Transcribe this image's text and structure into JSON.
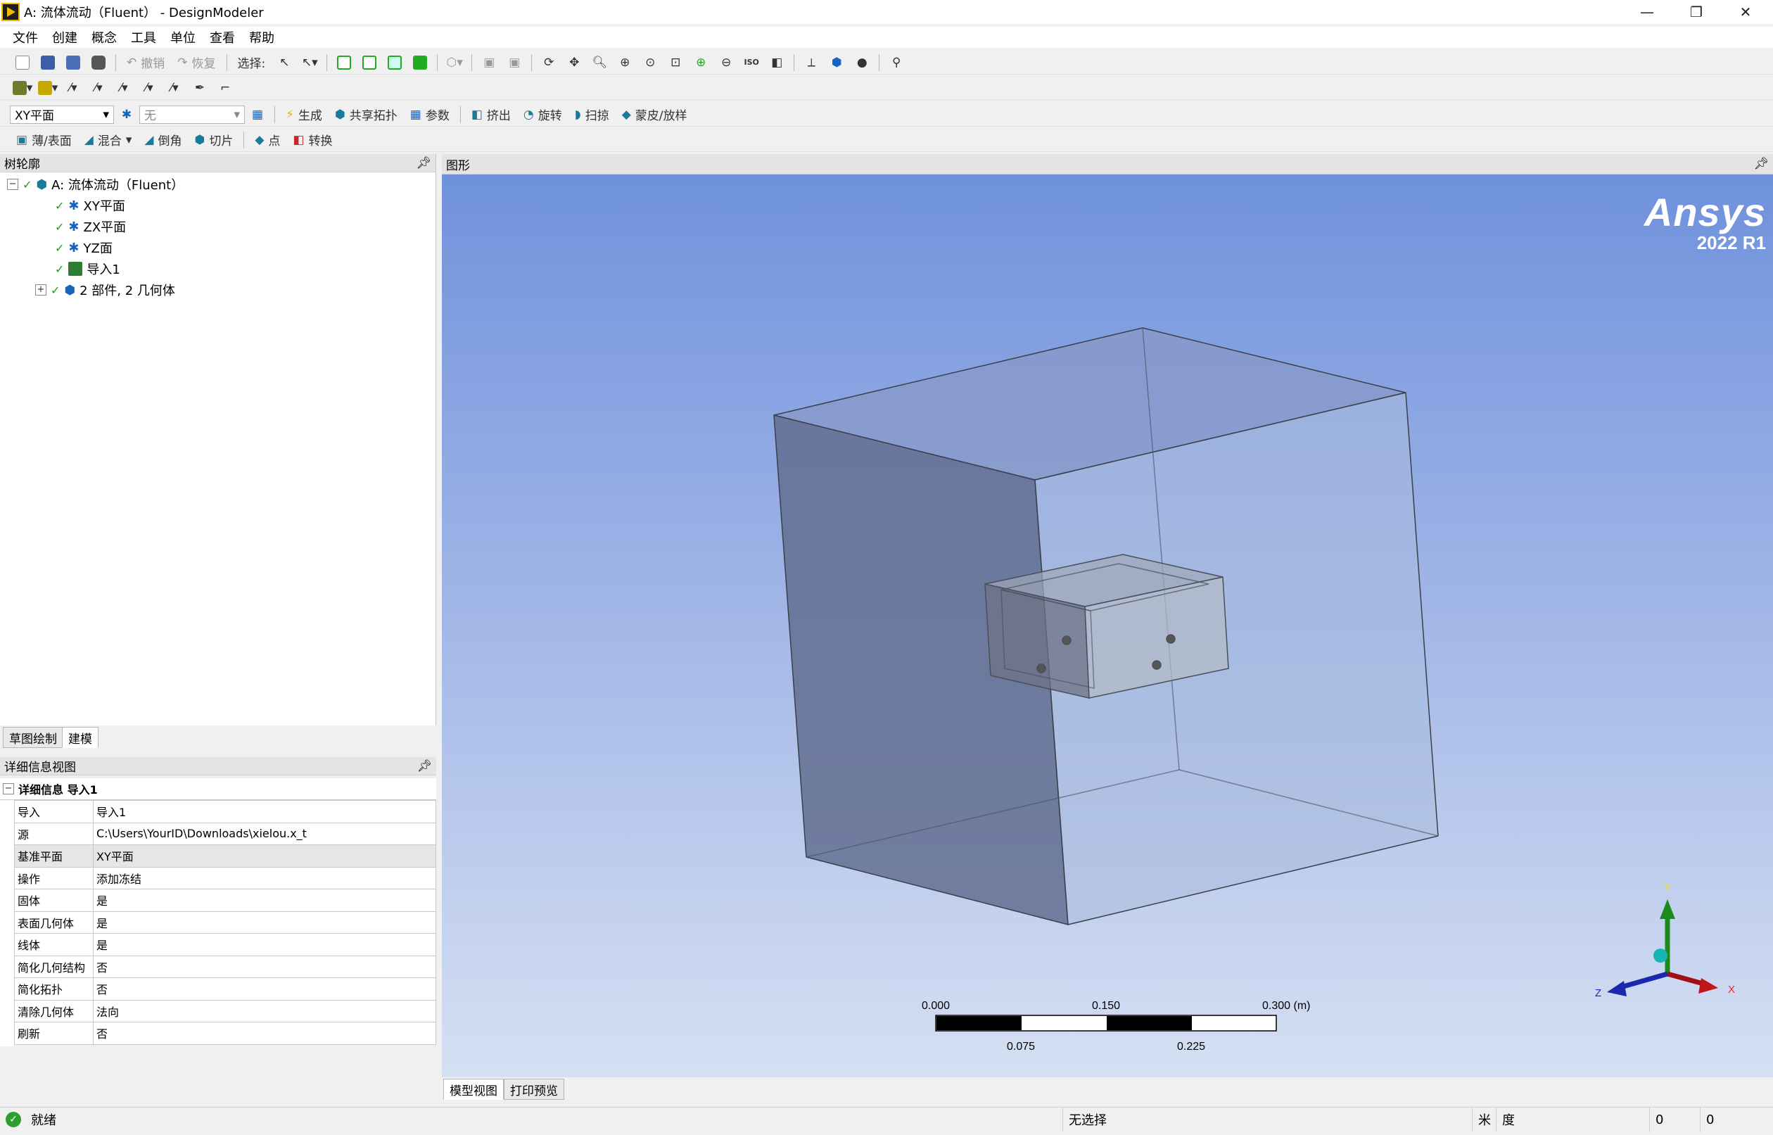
{
  "window": {
    "title": "A: 流体流动（Fluent） - DesignModeler",
    "minimize_glyph": "—",
    "maximize_glyph": "❐",
    "close_glyph": "✕"
  },
  "menu": [
    "文件",
    "创建",
    "概念",
    "工具",
    "单位",
    "查看",
    "帮助"
  ],
  "toolbar1": {
    "undo_label": "撤销",
    "redo_label": "恢复",
    "select_label": "选择:",
    "iso_label": "ISO"
  },
  "toolbar3": {
    "plane_value": "XY平面",
    "sketch_value": "无",
    "generate_label": "生成",
    "share_topology_label": "共享拓扑",
    "parameters_label": "参数",
    "extrude_label": "挤出",
    "revolve_label": "旋转",
    "sweep_label": "扫掠",
    "skin_loft_label": "蒙皮/放样"
  },
  "toolbar4": {
    "thin_surface_label": "薄/表面",
    "blend_label": "混合",
    "chamfer_label": "倒角",
    "slice_label": "切片",
    "point_label": "点",
    "convert_label": "转换"
  },
  "outline": {
    "title": "树轮廓",
    "root": "A: 流体流动（Fluent）",
    "items": [
      "XY平面",
      "ZX平面",
      "YZ面",
      "导入1",
      "2 部件, 2 几何体"
    ]
  },
  "left_tabs": {
    "sketching": "草图绘制",
    "modeling": "建模"
  },
  "details": {
    "title": "详细信息视图",
    "section": "详细信息 导入1",
    "rows": [
      {
        "key": "导入",
        "value": "导入1"
      },
      {
        "key": "源",
        "value": "C:\\Users\\YourID\\Downloads\\xielou.x_t"
      },
      {
        "key": "基准平面",
        "value": "XY平面"
      },
      {
        "key": "操作",
        "value": "添加冻结"
      },
      {
        "key": "固体",
        "value": "是"
      },
      {
        "key": "表面几何体",
        "value": "是"
      },
      {
        "key": "线体",
        "value": "是"
      },
      {
        "key": "简化几何结构",
        "value": "否"
      },
      {
        "key": "简化拓扑",
        "value": "否"
      },
      {
        "key": "清除几何体",
        "value": "法向"
      },
      {
        "key": "刷新",
        "value": "否"
      }
    ]
  },
  "graphics": {
    "title": "图形",
    "logo": "Ansys",
    "version": "2022 R1",
    "scale_top": [
      "0.000",
      "0.150",
      "0.300 (m)"
    ],
    "scale_bottom": [
      "0.075",
      "0.225"
    ],
    "axis_x": "X",
    "axis_y": "Y",
    "axis_z": "Z"
  },
  "bottom_tabs": {
    "model_view": "模型视图",
    "print_preview": "打印预览"
  },
  "status": {
    "ready": "就绪",
    "selection": "无选择",
    "length_unit": "米",
    "angle_unit": "度",
    "field1": "0",
    "field2": "0"
  },
  "colors": {
    "accent_green": "#16a016",
    "viewport_top": "#6f91dc",
    "viewport_bottom": "#d6e0f3",
    "ansys_logo": "#ffffff"
  }
}
